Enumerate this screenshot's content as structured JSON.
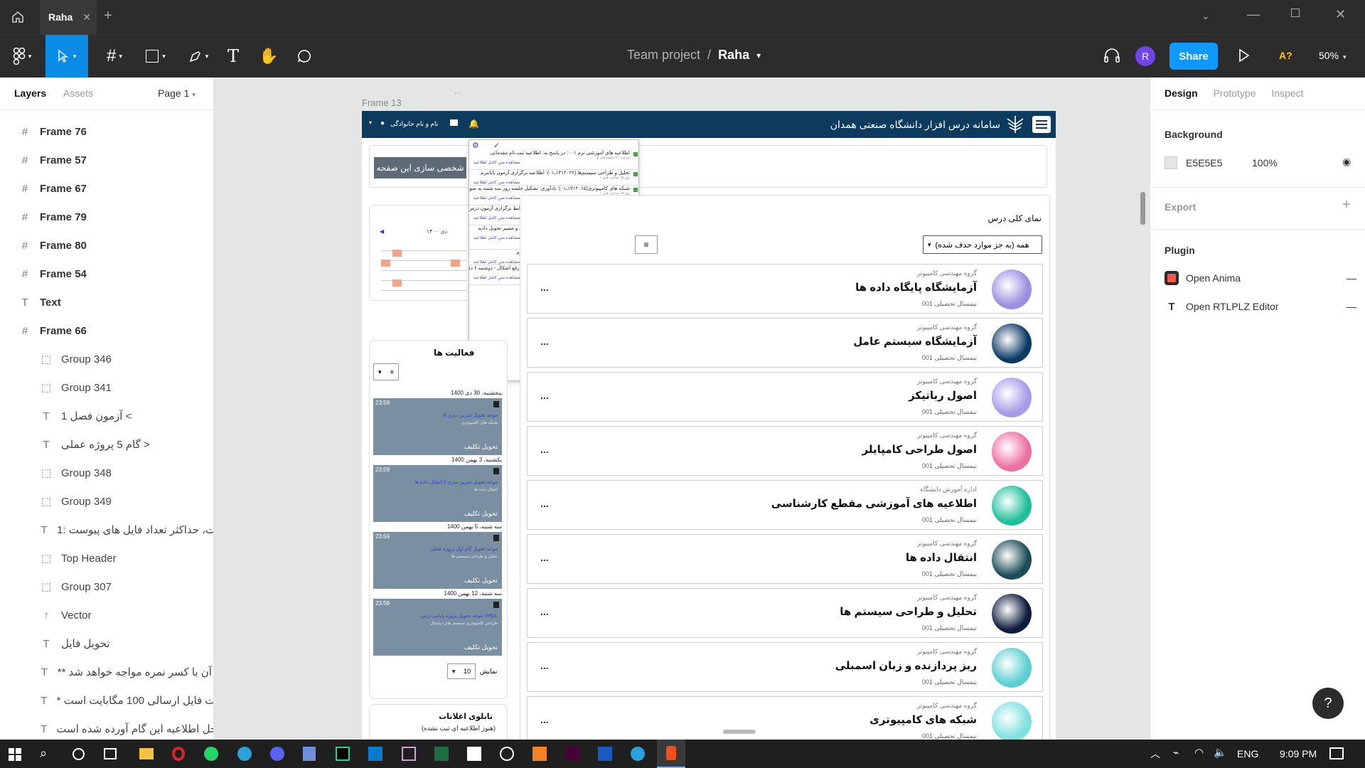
{
  "titlebar": {
    "tab_title": "Raha",
    "add_tab": "+"
  },
  "toolbar": {
    "breadcrumb_project": "Team project",
    "breadcrumb_sep": "/",
    "file_name": "Raha",
    "share_label": "Share",
    "avatar_initial": "R",
    "a11y_label": "A?",
    "zoom": "50%"
  },
  "left_panel": {
    "tabs": [
      "Layers",
      "Assets"
    ],
    "page": "Page 1",
    "layers": [
      {
        "label": "Frame 76",
        "icon": "frame",
        "level": "top"
      },
      {
        "label": "Frame 57",
        "icon": "frame",
        "level": "top"
      },
      {
        "label": "Frame 67",
        "icon": "frame",
        "level": "top"
      },
      {
        "label": "Frame 79",
        "icon": "frame",
        "level": "top"
      },
      {
        "label": "Frame 80",
        "icon": "frame",
        "level": "top"
      },
      {
        "label": "Frame 54",
        "icon": "frame",
        "level": "top"
      },
      {
        "label": "Text",
        "icon": "text",
        "level": "top"
      },
      {
        "label": "Frame 66",
        "icon": "frame",
        "level": "top"
      },
      {
        "label": "Group 346",
        "icon": "group",
        "level": "sub"
      },
      {
        "label": "Group 341",
        "icon": "group",
        "level": "sub"
      },
      {
        "label": "1 آزمون فصل <",
        "icon": "text",
        "level": "sub"
      },
      {
        "label": "گام 5 پروژه عملی >",
        "icon": "text",
        "level": "sub"
      },
      {
        "label": "Group 348",
        "icon": "group",
        "level": "sub"
      },
      {
        "label": "Group 349",
        "icon": "group",
        "level": "sub"
      },
      {
        "label": "1: مگابایت، حداکثر تعداد فایل های پیوست ...",
        "icon": "text",
        "level": "sub"
      },
      {
        "label": "Top Header",
        "icon": "group",
        "level": "sub"
      },
      {
        "label": "Group 307",
        "icon": "group",
        "level": "sub"
      },
      {
        "label": "Vector",
        "icon": "vector",
        "level": "sub"
      },
      {
        "label": "تحویل فایل",
        "icon": "text",
        "level": "sub"
      },
      {
        "label": "** عایت آن با کسر نمره مواجه خواهد شد...",
        "icon": "text",
        "level": "sub"
      },
      {
        "label": "* محدودیت فایل ارسالی 100 مگابایت است...",
        "icon": "text",
        "level": "sub"
      },
      {
        "label": "ویدیو داخل اطلاعیه این گام آورده شده است...",
        "icon": "text",
        "level": "sub"
      }
    ]
  },
  "right_panel": {
    "tabs": [
      "Design",
      "Prototype",
      "Inspect"
    ],
    "background_label": "Background",
    "bg_hex": "E5E5E5",
    "bg_opacity": "100%",
    "export_label": "Export",
    "plugin_label": "Plugin",
    "plugins": [
      "Open Anima",
      "Open RTLPLZ Editor"
    ]
  },
  "canvas": {
    "frame_label": "Frame 13",
    "frame_dots": "...",
    "site_title": "سامانه درس افزار دانشگاه صنعتی همدان",
    "user_name": "نام و نام خانوادگی",
    "customize_btn": "شخصی سازی این صفحه",
    "overview_title": "نمای کلی درس",
    "filter_label": "همه (به جز موارد حذف شده)",
    "courses": [
      {
        "dept": "گروه مهندسی کامپیوتر",
        "name": "آزمایشگاه پایگاه داده ها",
        "term": "نیمسال تحصیلی 001",
        "color": "#9b8fe0"
      },
      {
        "dept": "گروه مهندسی کامپیوتر",
        "name": "آزمایشگاه سیستم عامل",
        "term": "نیمسال تحصیلی 001",
        "color": "#0b3a66"
      },
      {
        "dept": "گروه مهندسی کامپیوتر",
        "name": "اصول رباتیکز",
        "term": "نیمسال تحصیلی 001",
        "color": "#a79be8"
      },
      {
        "dept": "گروه مهندسی کامپیوتر",
        "name": "اصول طراحی کامپایلر",
        "term": "نیمسال تحصیلی 001",
        "color": "#ee6fa0"
      },
      {
        "dept": "اداره آموزش دانشگاه",
        "name": "اطلاعیه های آموزشی مقطع کارشناسی",
        "term": "نیمسال تحصیلی 001",
        "color": "#1fbf9c"
      },
      {
        "dept": "گروه مهندسی کامپیوتر",
        "name": "انتقال داده ها",
        "term": "نیمسال تحصیلی 001",
        "color": "#1b4c57"
      },
      {
        "dept": "گروه مهندسی کامپیوتر",
        "name": "تحلیل و طراحی سیستم ها",
        "term": "نیمسال تحصیلی 001",
        "color": "#0d1c3d"
      },
      {
        "dept": "گروه مهندسی کامپیوتر",
        "name": "ریز پردازنده و زبان اسمبلی",
        "term": "نیمسال تحصیلی 001",
        "color": "#5ccfd0"
      },
      {
        "dept": "گروه مهندسی کامپیوتر",
        "name": "شبکه های کامپیوتری",
        "term": "نیمسال تحصیلی 001",
        "color": "#7fe0e0"
      }
    ],
    "activities_title": "فعالیت ها",
    "activities": [
      {
        "date": "پنجشنبه، 30 دی 1400",
        "time": "23:59",
        "title": "موعد تحویل تمرین سری 3",
        "sub": "شبکه های کامپیوتری",
        "btn": "تحویل تکلیف"
      },
      {
        "date": "یکشنبه، 3 بهمن 1400",
        "time": "23:59",
        "title": "موعد تحویل تمرین سری 2 انتقال داده ها",
        "sub": "انتقال داده ها",
        "btn": "تحویل تکلیف"
      },
      {
        "date": "سه شنبه، 5 بهمن 1400",
        "time": "23:59",
        "title": "موعد تحویل گام اول پروژه عملی",
        "sub": "تحلیل و طراحی سیستم ها",
        "btn": "تحویل تکلیف"
      },
      {
        "date": "سه شنبه، 12 بهمن 1400",
        "time": "23:59",
        "title": "موعد تحویل پروژه پایانی درس VHDL",
        "sub": "طراحی کامپیوتری سیستم های دیجیتال",
        "btn": "تحویل تکلیف"
      }
    ],
    "show_label": "نمایش",
    "show_count": "10",
    "board_title": "تابلوی اعلانات",
    "board_sub": "(هنوز اطلاعیه ای ثبت نشده)",
    "calendar_title": "دی ۱۴۰۰",
    "notifications": [
      {
        "text": "اطلاعیه های آموزشی ترم ۰۰۱: در پاسخ به: اطلاعیه ثبت نام مقدماتی",
        "time": "۵ ساعت ۴۱ دقیقه قبل",
        "link": "مشاهده متن کامل اطلاعیه"
      },
      {
        "text": "تحلیل و طراحی سیستم‌ها (۱۳۱۲۰۲۶ـ۰۱): اطلاعیه برگزاری آزمون پایانترم",
        "time": "۱ روز ۱۵ ساعت قبل",
        "link": "مشاهده متن کامل اطلاعیه"
      },
      {
        "text": "شبکه های کامپیوتری(۱۳۱۲۰۱۵ـ۰۱): یادآوری: تشکیل جلسه روز سه شنبه به صورت آنلاین",
        "time": "۱ روز ۱۸ ساعت قبل",
        "link": "مشاهده متن کامل اطلاعیه"
      },
      {
        "text": "آزمایشگاه سیستم های عامل(۱۳۱۰۰۵۷ـ۰۱): روز و شرایط برگزاری آزمون درس آزمایشگاه سیستم های عامل",
        "time": "۱ روز ۲۲ ساعت قبل",
        "link": "مشاهده متن کامل اطلاعیه"
      },
      {
        "text": "شما تکلیف خود را برای تمرین سری ۶ برنامه ریزی راه و مسیر تحویل دادید",
        "time": "۴ روز ۱ ساعت قبل",
        "link": "مشاهده متن کامل اطلاعیه"
      },
      {
        "text": "آزمایشگاه پایگاه داده ها(۱۳۱۲۰۳۹ـ۰۲): امتحان پایان ترم",
        "time": "۴ روز ۱۶ ساعت قبل",
        "link": "مشاهده متن کامل اطلاعیه"
      },
      {
        "text": "تحلیل و طراحی سیستم‌ها (۱۳۱۲۰۲۶ـ۰۱): کلاس آنلاین رفع اشکال - دوشنبه ۶ دی‌ماه",
        "time": "۶ روز ۲۳ ساعت قبل",
        "link": "مشاهده متن کامل اطلاعیه"
      }
    ]
  },
  "taskbar": {
    "lang": "ENG",
    "time": "9:09 PM"
  },
  "colors": {
    "accent": "#0d99ff",
    "header_blue": "#0d3b5e",
    "active_tool": "#0c8ce9"
  }
}
